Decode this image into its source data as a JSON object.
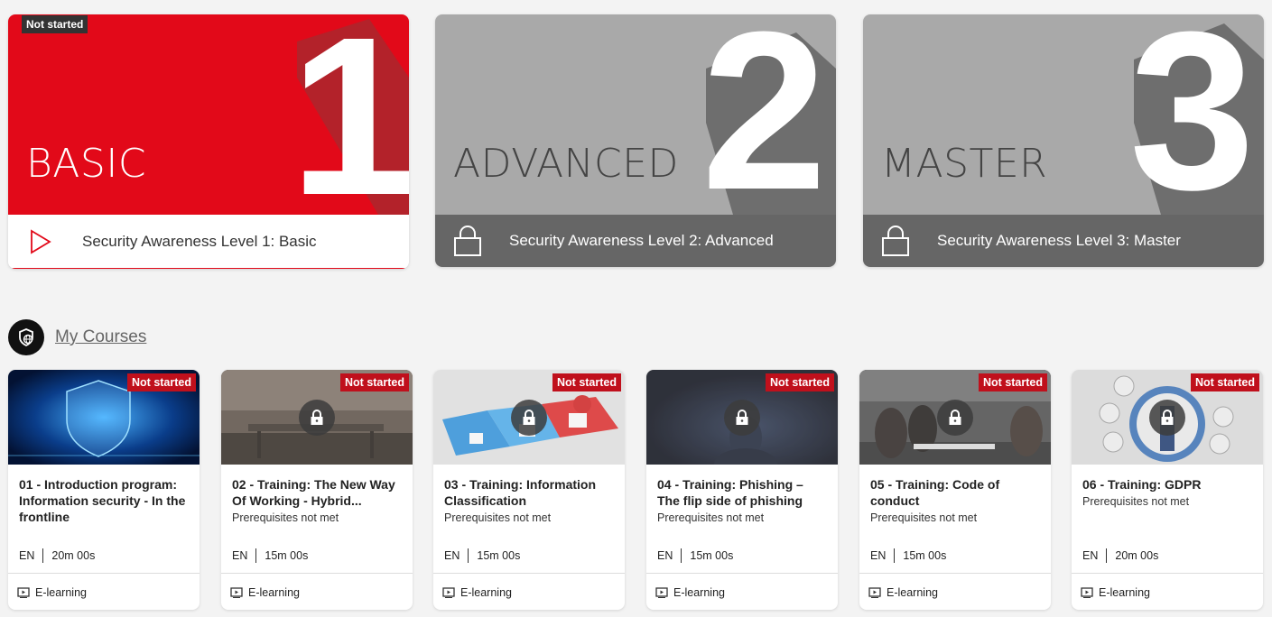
{
  "levels": [
    {
      "number": "1",
      "name": "BASIC",
      "title": "Security Awareness Level 1: Basic",
      "status": "Not started",
      "state": "available",
      "icon": "play-icon"
    },
    {
      "number": "2",
      "name": "ADVANCED",
      "title": "Security Awareness Level 2: Advanced",
      "state": "locked",
      "icon": "lock-icon"
    },
    {
      "number": "3",
      "name": "MASTER",
      "title": "Security Awareness Level 3: Master",
      "state": "locked",
      "icon": "lock-icon"
    }
  ],
  "courses_section": {
    "label": "My Courses",
    "icon": "shield-globe-icon"
  },
  "courses": [
    {
      "title": "01 - Introduction program: Information security - In the frontline",
      "prereq": "",
      "status": "Not started",
      "language": "EN",
      "duration": "20m 00s",
      "type": "E-learning",
      "locked": false
    },
    {
      "title": "02 - Training: The New Way Of Working - Hybrid...",
      "prereq": "Prerequisites not met",
      "status": "Not started",
      "language": "EN",
      "duration": "15m 00s",
      "type": "E-learning",
      "locked": true
    },
    {
      "title": "03 - Training: Information Classification",
      "prereq": "Prerequisites not met",
      "status": "Not started",
      "language": "EN",
      "duration": "15m 00s",
      "type": "E-learning",
      "locked": true
    },
    {
      "title": "04 - Training: Phishing – The flip side of phishing",
      "prereq": "Prerequisites not met",
      "status": "Not started",
      "language": "EN",
      "duration": "15m 00s",
      "type": "E-learning",
      "locked": true
    },
    {
      "title": "05 - Training: Code of conduct",
      "prereq": "Prerequisites not met",
      "status": "Not started",
      "language": "EN",
      "duration": "15m 00s",
      "type": "E-learning",
      "locked": true
    },
    {
      "title": "06 - Training: GDPR",
      "prereq": "Prerequisites not met",
      "status": "Not started",
      "language": "EN",
      "duration": "20m 00s",
      "type": "E-learning",
      "locked": true
    }
  ],
  "colors": {
    "brand_red": "#e20919",
    "badge_red": "#c0101c",
    "locked_grey": "#a9a9a9",
    "footer_grey": "#666666"
  }
}
